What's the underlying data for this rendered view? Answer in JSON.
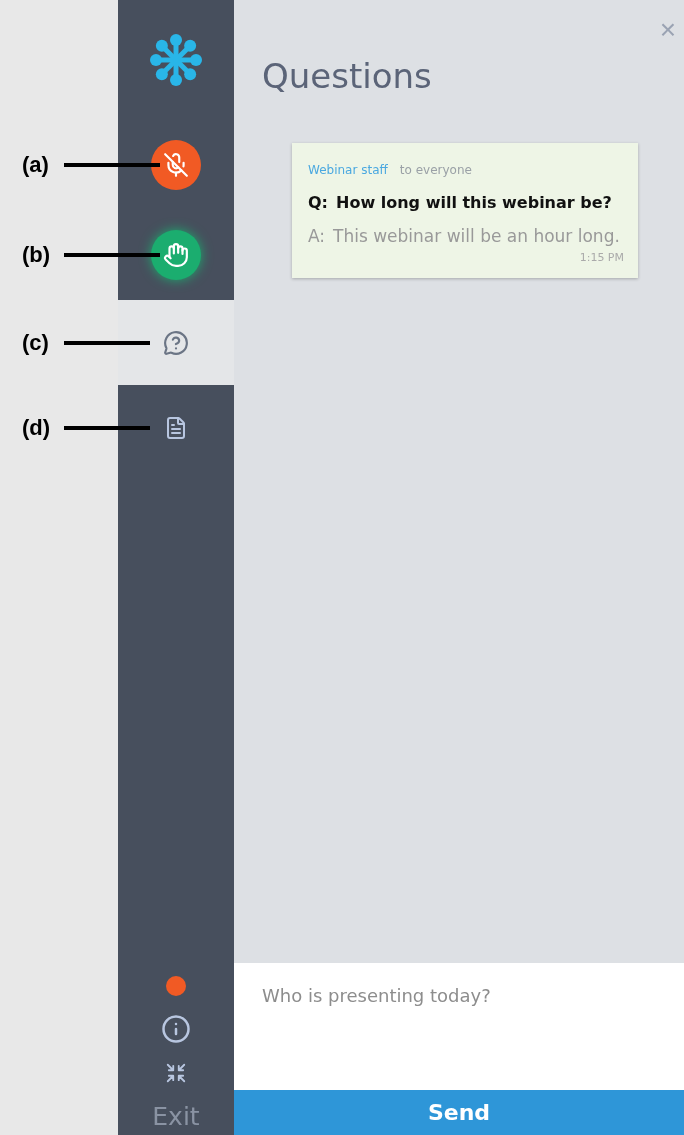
{
  "sidebar": {
    "items": [
      {
        "kind": "logo"
      },
      {
        "kind": "mute",
        "callout": "(a)",
        "selected": false
      },
      {
        "kind": "hand",
        "callout": "(b)",
        "selected": false
      },
      {
        "kind": "questions",
        "callout": "(c)",
        "selected": true
      },
      {
        "kind": "handouts",
        "callout": "(d)",
        "selected": false
      }
    ],
    "footer": {
      "status_dot": {
        "color": "#f15a24"
      },
      "exit": "Exit"
    }
  },
  "panel": {
    "close": "×",
    "title": "Questions",
    "messages": [
      {
        "sender": "Webinar staff",
        "audience": "to everyone",
        "q_prefix": "Q:",
        "question": "How long will this webinar be?",
        "a_prefix": "A:",
        "answer": "This webinar will be an hour long.",
        "time": "1:15 PM"
      }
    ],
    "input": {
      "placeholder": "Who is presenting today?"
    },
    "send": "Send"
  }
}
